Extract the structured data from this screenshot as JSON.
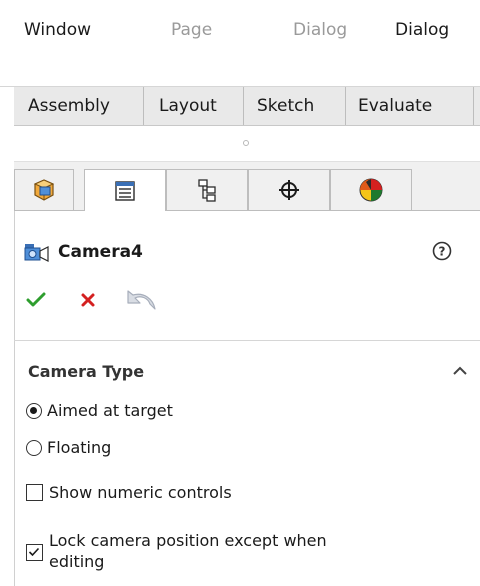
{
  "menu": {
    "items": [
      {
        "label": "Window",
        "dim": false
      },
      {
        "label": "Page",
        "dim": true
      },
      {
        "label": "Dialog",
        "dim": true
      },
      {
        "label": "Dialog",
        "dim": false
      }
    ]
  },
  "command_tabs": [
    "Assembly",
    "Layout",
    "Sketch",
    "Evaluate"
  ],
  "manager_tabs": [
    {
      "icon": "feature-manager-icon",
      "active": false
    },
    {
      "icon": "property-manager-icon",
      "active": true
    },
    {
      "icon": "configuration-manager-icon",
      "active": false
    },
    {
      "icon": "dimxpert-manager-icon",
      "active": false
    },
    {
      "icon": "display-manager-icon",
      "active": false
    }
  ],
  "property_manager": {
    "title": "Camera4",
    "help_icon": "help-icon",
    "ok_icon": "checkmark-icon",
    "cancel_icon": "close-icon",
    "undo_icon": "undo-icon"
  },
  "camera_type": {
    "title": "Camera Type",
    "collapse_icon": "chevron-up-icon",
    "options": [
      {
        "label": "Aimed at target",
        "selected": true
      },
      {
        "label": "Floating",
        "selected": false
      }
    ]
  },
  "checkboxes": [
    {
      "label": "Show numeric controls",
      "checked": false
    },
    {
      "label_line1": "Lock camera position except when",
      "label_line2": "editing",
      "checked": true
    }
  ],
  "colors": {
    "ok_green": "#2e9e2e",
    "cancel_red": "#d42020",
    "tab_bg": "#e9e9e9"
  }
}
